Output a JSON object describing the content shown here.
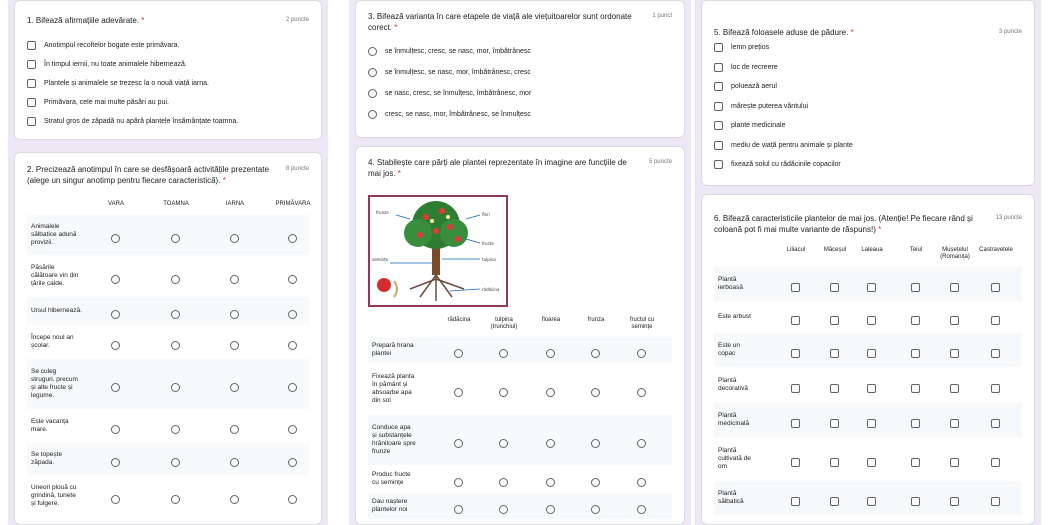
{
  "q1": {
    "title": "1. Bifează afirmațiile adevărate.",
    "required": "*",
    "points": "2 puncte",
    "options": [
      "Anotimpul recoltelor bogate este primăvara.",
      "În timpul iernii, nu toate animalele hibernează.",
      "Plantele și animalele se trezesc la o nouă viață iarna.",
      "Primăvara, cele mai multe păsări au pui.",
      "Stratul gros de zăpadă nu apără plantele însămânțate toamna."
    ]
  },
  "q2": {
    "title_line1": "2. Precizează anotimpul în care se desfășoară activitățile prezentate",
    "title_line2": "(alege un singur anotimp pentru fiecare caracteristică).",
    "required": "*",
    "points": "8 puncte",
    "columns": [
      "VARA",
      "TOAMNA",
      "IARNA",
      "PRIMĂVARA"
    ],
    "rows": [
      [
        "Animalele",
        "sălbatice adună",
        "provizii."
      ],
      [
        "Păsările",
        "călătoare vin din",
        "țările calde."
      ],
      [
        "Ursul hibernează."
      ],
      [
        "Începe noul an",
        "școlar."
      ],
      [
        "Se culeg",
        "struguri, precum",
        "și alte fructe și",
        "legume."
      ],
      [
        "Este vacanța",
        "mare."
      ],
      [
        "Se topește",
        "zăpada."
      ],
      [
        "Uneori plouă cu",
        "grindină, tunete",
        "și fulgere."
      ]
    ]
  },
  "q3": {
    "title_line1": "3. Bifează varianta în care etapele de viață ale viețuitoarelor sunt ordonate",
    "title_line2": "corect.",
    "required": "*",
    "points": "1 punct",
    "options": [
      "se înmulțesc, cresc, se nasc, mor, îmbătrânesc",
      "se înmulțesc, se nasc, mor, îmbătrânesc, cresc",
      "se nasc, cresc, se înmulțesc, îmbătrânesc, mor",
      "cresc, se nasc, mor, îmbătrânesc, se înmulțesc"
    ]
  },
  "q4": {
    "title_line1": "4. Stabilește care părți ale plantei reprezentate în imagine are funcțiile de",
    "title_line2": "mai jos.",
    "required": "*",
    "points": "5 puncte",
    "image_labels": [
      "frunze",
      "flori",
      "fructe",
      "tulpina",
      "rădăcina",
      "semințe"
    ],
    "columns": [
      [
        "rădăcina"
      ],
      [
        "tulpina",
        "(trunchiul)"
      ],
      [
        "floarea"
      ],
      [
        "frunza"
      ],
      [
        "fructul cu",
        "semințe"
      ]
    ],
    "rows": [
      [
        "Prepară hrana",
        "plantei"
      ],
      [
        "Fixează planta",
        "în pământ și",
        "absoarbe apa",
        "din sol"
      ],
      [
        "Conduce apa",
        "și substanțele",
        "hrănitoare spre",
        "frunze"
      ],
      [
        "Produc fructe",
        "cu semințe"
      ],
      [
        "Dau naștere",
        "plantelor noi"
      ]
    ]
  },
  "q5": {
    "title": "5. Bifează foloasele aduse de pădure.",
    "required": "*",
    "points": "3 puncte",
    "options": [
      "lemn prețios",
      "loc de recreere",
      "poluează aerul",
      "mărește puterea vântului",
      "plante medicinale",
      "mediu de viață pentru animale și plante",
      "fixează solul cu rădăcinile copacilor"
    ]
  },
  "q6": {
    "title_line1": "6. Bifează caracteristicile plantelor de mai jos. (Atenție! Pe fiecare rând și",
    "title_line2": "coloană pot fi mai multe variante de răspuns!)",
    "required": "*",
    "points": "13 puncte",
    "columns": [
      [
        "Liliacul"
      ],
      [
        "Măceșul"
      ],
      [
        "Laleaua"
      ],
      [
        "Teiul"
      ],
      [
        "Mușețelul",
        "(Romanița)"
      ],
      [
        "Castravetele"
      ]
    ],
    "rows": [
      [
        "Plantă",
        "ierboasă"
      ],
      [
        "Este arbust"
      ],
      [
        "Este un",
        "copac"
      ],
      [
        "Plantă",
        "decorativă"
      ],
      [
        "Plantă",
        "medicinală"
      ],
      [
        "Plantă",
        "cultivată de",
        "om"
      ],
      [
        "Plantă",
        "sălbatică"
      ]
    ]
  },
  "colors": {
    "background": "#ede7f6",
    "card": "#ffffff",
    "text": "#202124",
    "required": "#d93025",
    "control": "#5f6368"
  }
}
